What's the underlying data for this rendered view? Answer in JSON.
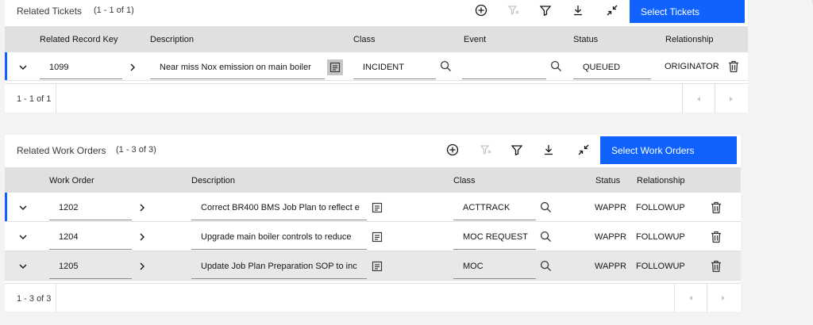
{
  "tickets": {
    "title": "Related Tickets",
    "count": "(1 - 1 of 1)",
    "select_label": "Select Tickets",
    "columns": [
      "Related Record Key",
      "Description",
      "Class",
      "Event",
      "Status",
      "Relationship"
    ],
    "rows": [
      {
        "key": "1099",
        "description": "Near miss Nox emission on main boiler",
        "class": "INCIDENT",
        "event": "",
        "status": "QUEUED",
        "relationship": "ORIGINATOR"
      }
    ],
    "pagination": "1 - 1 of 1"
  },
  "work_orders": {
    "title": "Related Work Orders",
    "count": "(1 - 3 of 3)",
    "select_label": "Select Work Orders",
    "columns": [
      "Work Order",
      "Description",
      "Class",
      "Status",
      "Relationship"
    ],
    "rows": [
      {
        "wo": "1202",
        "description": "Correct BR400 BMS Job Plan to reflect e",
        "class": "ACTTRACK",
        "status": "WAPPR",
        "relationship": "FOLLOWUP"
      },
      {
        "wo": "1204",
        "description": "Upgrade main boiler controls to reduce",
        "class": "MOC REQUEST",
        "status": "WAPPR",
        "relationship": "FOLLOWUP"
      },
      {
        "wo": "1205",
        "description": "Update Job Plan Preparation SOP to inc",
        "class": "MOC",
        "status": "WAPPR",
        "relationship": "FOLLOWUP"
      }
    ],
    "pagination": "1 - 3 of 3"
  },
  "icons": {
    "add": "add-icon",
    "filter_clear": "filter-remove-icon",
    "filter": "filter-icon",
    "download": "download-icon",
    "collapse": "minimize-icon",
    "detail": "document-icon",
    "lookup": "search-icon",
    "delete": "trash-icon",
    "expand": "chevron-down-icon",
    "navigate": "chevron-right-icon"
  },
  "colors": {
    "primary": "#0f62fe",
    "header_bg": "#e0e0e0",
    "page_bg": "#f3f3f3"
  }
}
